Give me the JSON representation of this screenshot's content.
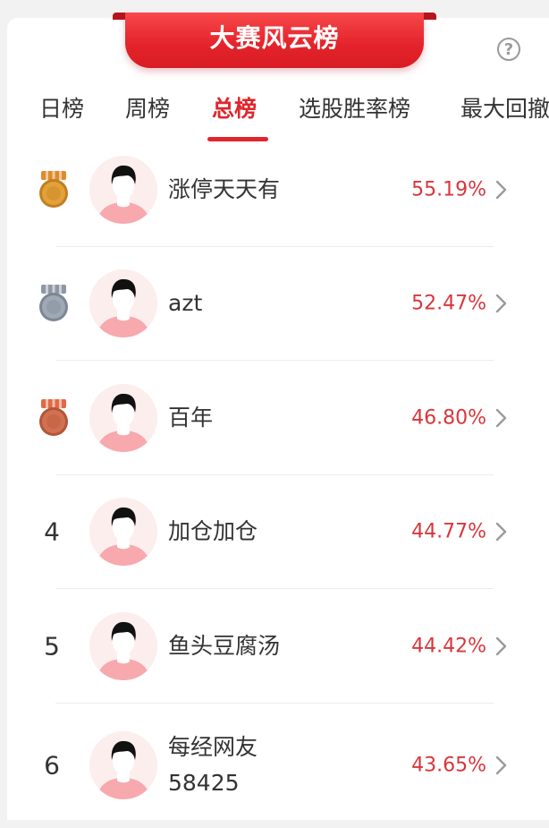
{
  "banner": {
    "title": "大赛风云榜",
    "help_icon": "?"
  },
  "tabs": [
    {
      "label": "日榜",
      "active": false
    },
    {
      "label": "周榜",
      "active": false
    },
    {
      "label": "总榜",
      "active": true
    },
    {
      "label": "选股胜率榜",
      "active": false
    },
    {
      "label": "最大回撤",
      "active": false
    }
  ],
  "leaderboard": [
    {
      "rank": "1",
      "medal": "gold",
      "name": "涨停天天有",
      "rate": "55.19%"
    },
    {
      "rank": "2",
      "medal": "silver",
      "name": "azt",
      "rate": "52.47%"
    },
    {
      "rank": "3",
      "medal": "bronze",
      "name": "百年",
      "rate": "46.80%"
    },
    {
      "rank": "4",
      "medal": "",
      "name": "加仓加仓",
      "rate": "44.77%"
    },
    {
      "rank": "5",
      "medal": "",
      "name": "鱼头豆腐汤",
      "rate": "44.42%"
    },
    {
      "rank": "6",
      "medal": "",
      "name": "每经网友\n58425",
      "rate": "43.65%"
    }
  ],
  "colors": {
    "accent": "#e0262c",
    "rate": "#d8363b",
    "gold": "#e2a13a",
    "silver": "#9fa9b5",
    "bronze": "#d2714f",
    "avatar_bg": "#fdeeee",
    "avatar_shirt": "#f7a9ae"
  }
}
